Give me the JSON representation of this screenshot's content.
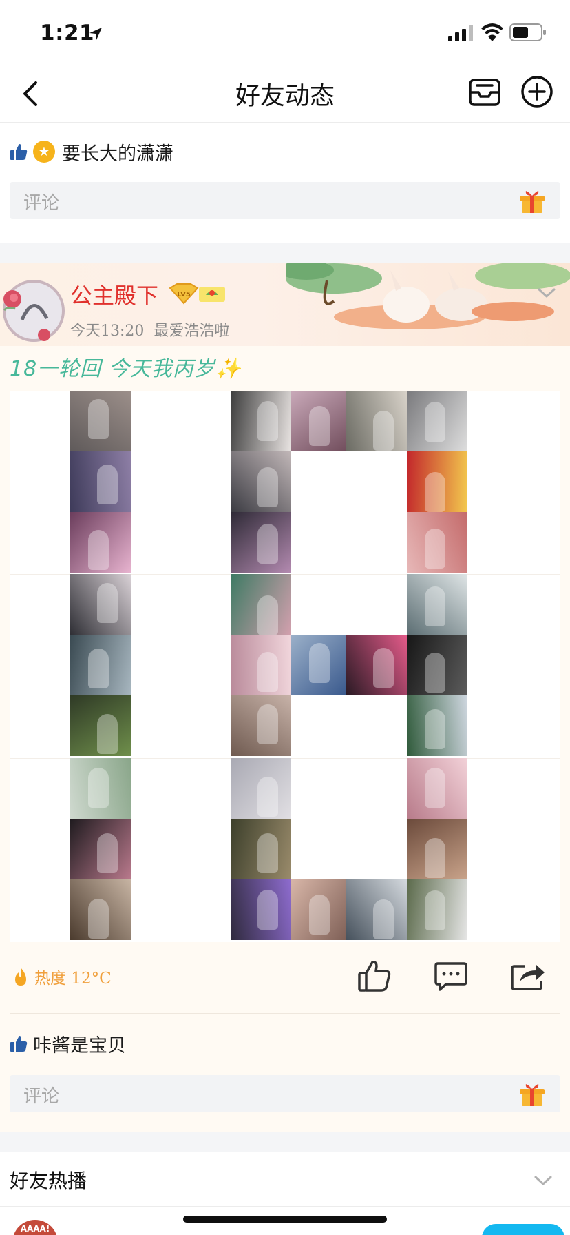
{
  "status_bar": {
    "time": "1:21"
  },
  "nav": {
    "title": "好友动态"
  },
  "top_like": {
    "name": "要长大的潇潇"
  },
  "comment": {
    "placeholder": "评论"
  },
  "post": {
    "author": "公主殿下",
    "vip_level": "LV5",
    "time": "今天13:20",
    "source": "最爱浩浩啦",
    "text": "18一轮回 今天我丙岁✨",
    "heat_label": "热度 12°C",
    "liker": "咔酱是宝贝"
  },
  "friends_hot": {
    "title": "好友热播",
    "avatar_text": "AAAA!"
  },
  "colors": {
    "accent_red": "#e0312d",
    "heat_orange": "#f0a03d",
    "like_blue": "#2b5fa8",
    "post_text_green": "#47b89a",
    "pill_blue": "#14b8f0"
  },
  "icons": {
    "back": "chevron-left-icon",
    "inbox": "inbox-icon",
    "add": "plus-circle-icon",
    "thumb": "thumbs-up-icon",
    "gift": "gift-icon",
    "flame": "flame-icon",
    "comment": "comment-bubble-icon",
    "share": "share-icon"
  }
}
